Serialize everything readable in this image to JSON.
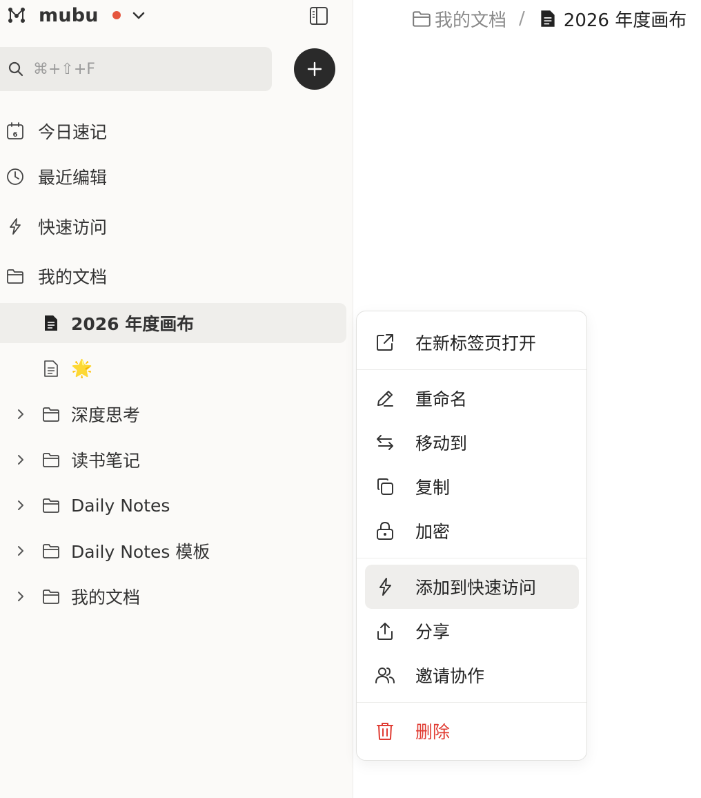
{
  "app": {
    "name": "mubu",
    "accent": "#e5553e"
  },
  "search": {
    "placeholder": "⌘+⇧+F"
  },
  "nav": [
    {
      "label": "今日速记",
      "icon": "calendar-icon"
    },
    {
      "label": "最近编辑",
      "icon": "clock-icon"
    },
    {
      "label": "快速访问",
      "icon": "bolt-icon"
    },
    {
      "label": "我的文档",
      "icon": "folder-icon"
    }
  ],
  "tree": [
    {
      "label": "2026 年度画布",
      "type": "document",
      "selected": true
    },
    {
      "label": "🌟",
      "type": "document"
    },
    {
      "label": "深度思考",
      "type": "folder"
    },
    {
      "label": "读书笔记",
      "type": "folder"
    },
    {
      "label": "Daily Notes",
      "type": "folder"
    },
    {
      "label": "Daily Notes 模板",
      "type": "folder"
    },
    {
      "label": "我的文档",
      "type": "folder"
    }
  ],
  "breadcrumb": {
    "folder": "我的文档",
    "separator": "/",
    "document": "2026 年度画布"
  },
  "context_menu": {
    "items": [
      {
        "label": "在新标签页打开",
        "icon": "external-link-icon"
      },
      {
        "label": "重命名",
        "icon": "pencil-icon"
      },
      {
        "label": "移动到",
        "icon": "arrows-swap-icon"
      },
      {
        "label": "复制",
        "icon": "copy-icon"
      },
      {
        "label": "加密",
        "icon": "lock-icon"
      },
      {
        "label": "添加到快速访问",
        "icon": "bolt-icon",
        "hovered": true
      },
      {
        "label": "分享",
        "icon": "share-icon"
      },
      {
        "label": "邀请协作",
        "icon": "users-icon"
      },
      {
        "label": "删除",
        "icon": "trash-icon",
        "color": "#e03c33"
      }
    ]
  }
}
